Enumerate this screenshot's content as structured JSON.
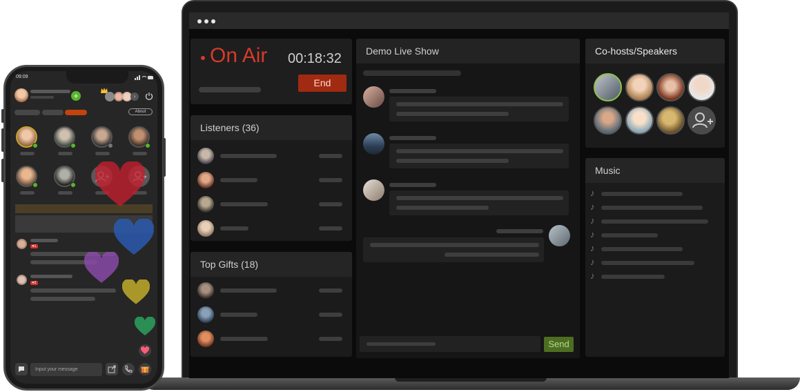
{
  "laptop": {
    "broadcast": {
      "status_label": "On Air",
      "timer": "00:18:32",
      "end_label": "End"
    },
    "listeners": {
      "title": "Listeners (36)"
    },
    "top_gifts": {
      "title": "Top Gifts (18)"
    },
    "chat": {
      "title": "Demo Live Show",
      "send_label": "Send"
    },
    "cohosts": {
      "title": "Co-hosts/Speakers"
    },
    "music": {
      "title": "Music",
      "note_icon": "♪"
    }
  },
  "phone": {
    "status_time": "09:09",
    "about_label": "About",
    "message_placeholder": "Input your message"
  },
  "colors": {
    "accent_red": "#d63a2a",
    "end_button": "#a12a12",
    "send_button": "#4d6e22",
    "speaking_ring": "#8bc34a",
    "tab_active": "#c1440e"
  }
}
